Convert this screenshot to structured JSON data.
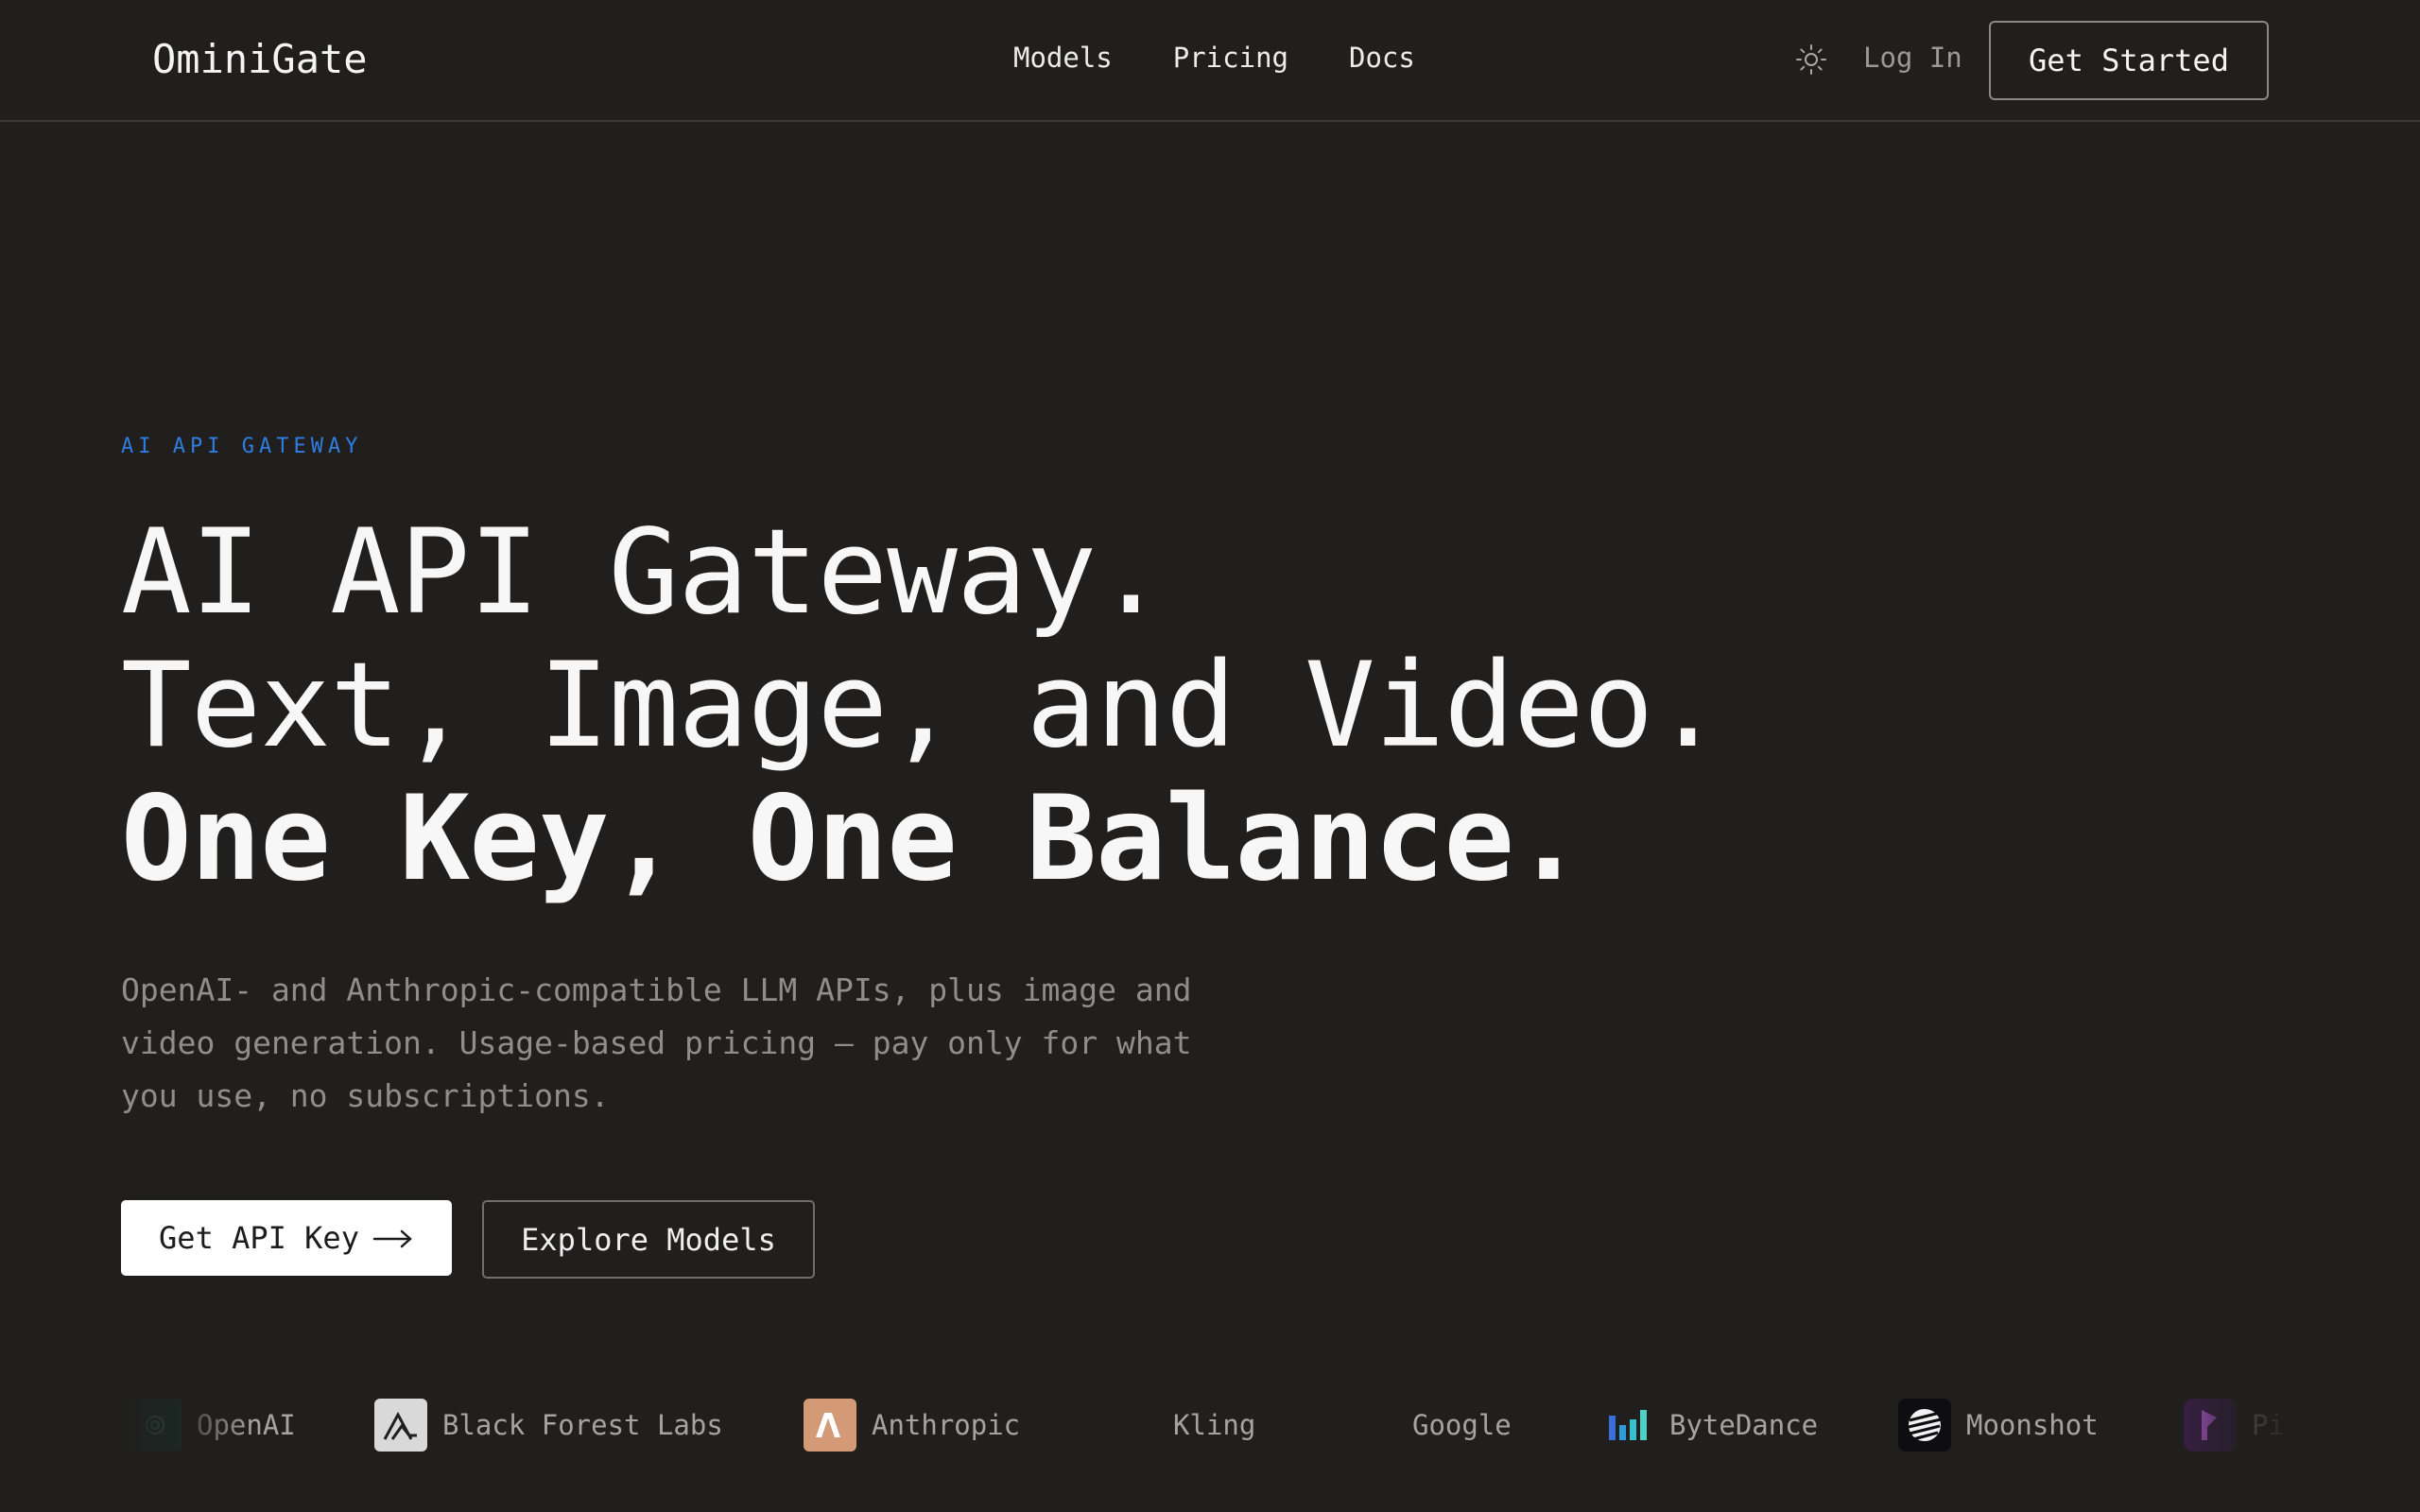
{
  "nav": {
    "logo": "OminiGate",
    "links": [
      "Models",
      "Pricing",
      "Docs"
    ],
    "login": "Log In",
    "cta": "Get Started",
    "theme_icon": "sun-icon"
  },
  "hero": {
    "eyebrow": "AI API GATEWAY",
    "headline_lines": [
      "AI API Gateway.",
      "Text, Image, and Video.",
      "One Key, One Balance."
    ],
    "subtext": "OpenAI- and Anthropic-compatible LLM APIs, plus image and video generation. Usage-based pricing — pay only for what you use, no subscriptions.",
    "primary_cta": "Get API Key",
    "primary_cta_icon": "arrow-right-icon",
    "secondary_cta": "Explore Models"
  },
  "providers": [
    {
      "name": "OpenAI",
      "icon": "openai-logo-icon"
    },
    {
      "name": "Black Forest Labs",
      "icon": "black-forest-labs-logo-icon"
    },
    {
      "name": "Anthropic",
      "icon": "anthropic-logo-icon"
    },
    {
      "name": "Kling",
      "icon": ""
    },
    {
      "name": "Google",
      "icon": ""
    },
    {
      "name": "ByteDance",
      "icon": "bytedance-logo-icon"
    },
    {
      "name": "Moonshot",
      "icon": "moonshot-logo-icon"
    },
    {
      "name": "Pi",
      "icon": "pika-logo-icon"
    }
  ],
  "colors": {
    "background": "#201f1e",
    "accent": "#2f7de1",
    "text": "#f7f7f7",
    "muted": "#8f8e8d"
  }
}
